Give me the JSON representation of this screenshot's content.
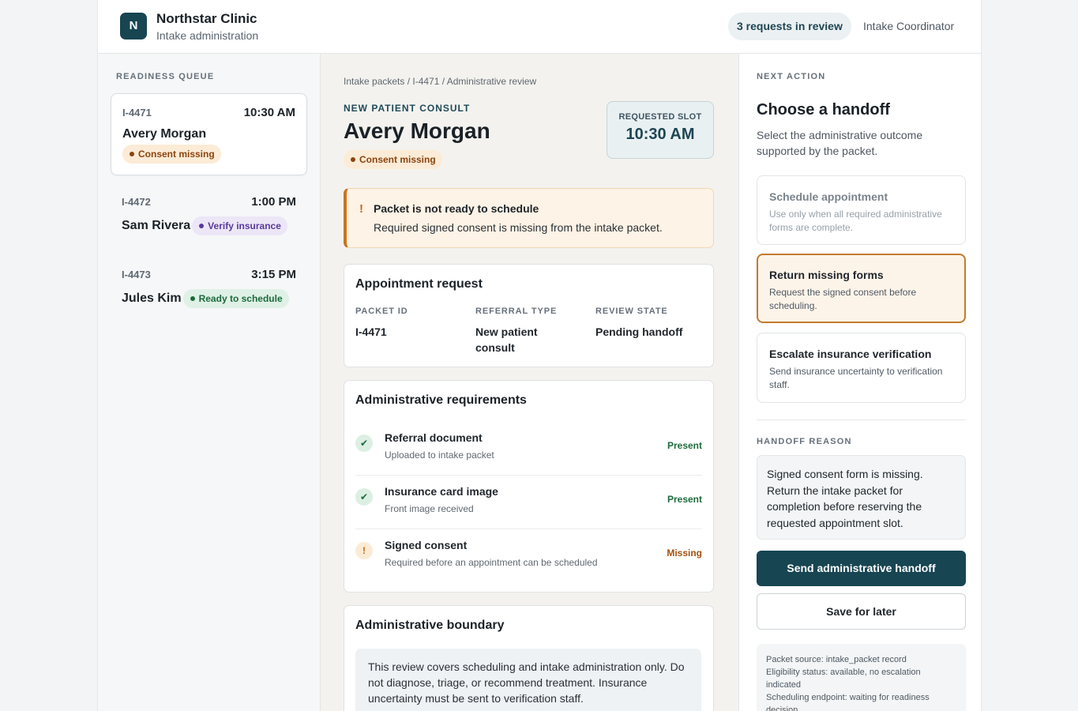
{
  "header": {
    "logo_letter": "N",
    "clinic_name": "Northstar Clinic",
    "subtitle": "Intake administration",
    "review_pill": "3 requests in review",
    "role": "Intake Coordinator"
  },
  "queue": {
    "title": "READINESS QUEUE",
    "items": [
      {
        "id": "I-4471",
        "time": "10:30 AM",
        "name": "Avery Morgan",
        "status": "Consent missing",
        "status_kind": "warn"
      },
      {
        "id": "I-4472",
        "time": "1:00 PM",
        "name": "Sam Rivera",
        "status": "Verify insurance",
        "status_kind": "insurance"
      },
      {
        "id": "I-4473",
        "time": "3:15 PM",
        "name": "Jules Kim",
        "status": "Ready to schedule",
        "status_kind": "ok"
      }
    ]
  },
  "detail": {
    "breadcrumb": "Intake packets / I-4471 / Administrative review",
    "consult_type": "NEW PATIENT CONSULT",
    "patient_name": "Avery Morgan",
    "status": "Consent missing",
    "slot_label": "REQUESTED SLOT",
    "slot_time": "10:30 AM",
    "alert": {
      "icon": "!",
      "title": "Packet is not ready to schedule",
      "text": "Required signed consent is missing from the intake packet."
    },
    "request": {
      "title": "Appointment request",
      "fields": [
        {
          "label": "PACKET ID",
          "value": "I-4471"
        },
        {
          "label": "REFERRAL TYPE",
          "value": "New patient consult"
        },
        {
          "label": "REVIEW STATE",
          "value": "Pending handoff"
        }
      ]
    },
    "requirements": {
      "title": "Administrative requirements",
      "items": [
        {
          "name": "Referral document",
          "sub": "Uploaded to intake packet",
          "state": "Present",
          "icon": "✔"
        },
        {
          "name": "Insurance card image",
          "sub": "Front image received",
          "state": "Present",
          "icon": "✔"
        },
        {
          "name": "Signed consent",
          "sub": "Required before an appointment can be scheduled",
          "state": "Missing",
          "icon": "!"
        }
      ]
    },
    "boundary": {
      "title": "Administrative boundary",
      "text": "This review covers scheduling and intake administration only. Do not diagnose, triage, or recommend treatment. Insurance uncertainty must be sent to verification staff."
    }
  },
  "action": {
    "eyebrow": "NEXT ACTION",
    "title": "Choose a handoff",
    "subtitle": "Select the administrative outcome supported by the packet.",
    "options": [
      {
        "title": "Schedule appointment",
        "sub": "Use only when all required administrative forms are complete.",
        "state": "disabled"
      },
      {
        "title": "Return missing forms",
        "sub": "Request the signed consent before scheduling.",
        "state": "selected"
      },
      {
        "title": "Escalate insurance verification",
        "sub": "Send insurance uncertainty to verification staff.",
        "state": "default"
      }
    ],
    "reason_label": "HANDOFF REASON",
    "reason_text": "Signed consent form is missing. Return the intake packet for completion before reserving the requested appointment slot.",
    "primary_button": "Send administrative handoff",
    "secondary_button": "Save for later",
    "meta": [
      "Packet source: intake_packet record",
      "Eligibility status: available, no escalation indicated",
      "Scheduling endpoint: waiting for readiness decision"
    ]
  },
  "colors": {
    "brand": "#174552",
    "warn": "#c9731f",
    "ok": "#1d6b3c",
    "insurance": "#5a3a9a"
  }
}
